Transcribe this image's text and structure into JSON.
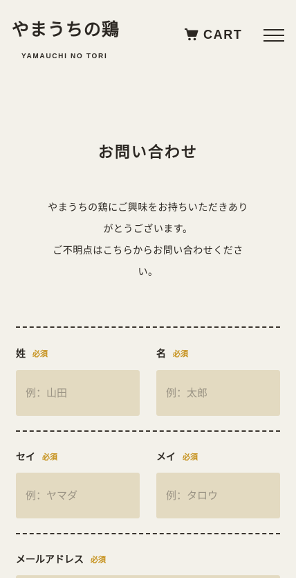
{
  "header": {
    "logo_title": "やまうちの鶏",
    "logo_subtitle": "YAMAUCHI NO TORI",
    "cart_label": "CART"
  },
  "page": {
    "title": "お問い合わせ",
    "intro_lines": [
      "やまうちの鶏にご興味をお持ちいただきあり",
      "がとうございます。",
      "ご不明点はこちらからお問い合わせくださ",
      "い。"
    ]
  },
  "form": {
    "required_label": "必須",
    "fields": {
      "last_name": {
        "label": "姓",
        "placeholder": "例：山田"
      },
      "first_name": {
        "label": "名",
        "placeholder": "例：太郎"
      },
      "last_name_kana": {
        "label": "セイ",
        "placeholder": "例：ヤマダ"
      },
      "first_name_kana": {
        "label": "メイ",
        "placeholder": "例：タロウ"
      },
      "email": {
        "label": "メールアドレス"
      }
    }
  },
  "colors": {
    "background": "#f3f1ea",
    "input_background": "#e3dac1",
    "required_accent": "#c6921d",
    "text": "#2c2823"
  },
  "icons": {
    "cart": "cart-icon",
    "menu": "hamburger-menu-icon"
  }
}
